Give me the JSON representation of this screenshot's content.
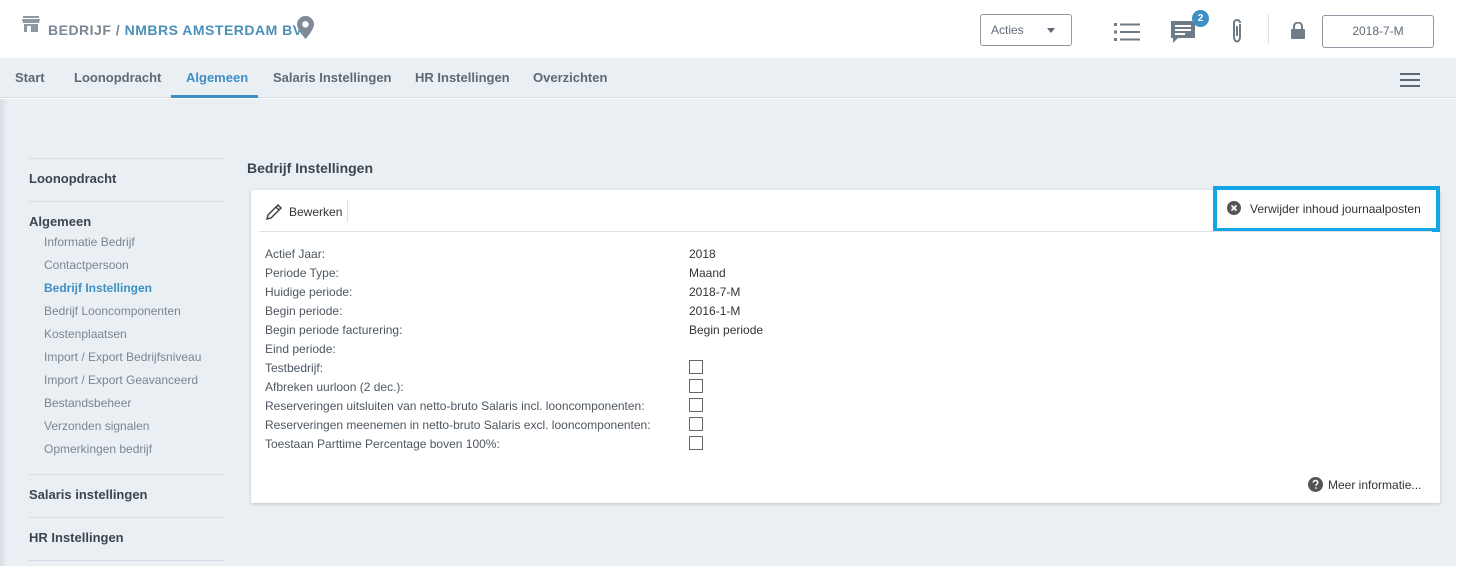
{
  "header": {
    "breadcrumb_prefix": "BEDRIJF /",
    "company": "NMBRS AMSTERDAM BV",
    "actions_label": "Acties",
    "chat_badge": "2",
    "period": "2018-7-M"
  },
  "nav": {
    "tabs": [
      {
        "label": "Start"
      },
      {
        "label": "Loonopdracht"
      },
      {
        "label": "Algemeen"
      },
      {
        "label": "Salaris Instellingen"
      },
      {
        "label": "HR Instellingen"
      },
      {
        "label": "Overzichten"
      }
    ],
    "active_tab": "Algemeen"
  },
  "sidebar": {
    "sections": [
      {
        "label": "Loonopdracht"
      },
      {
        "label": "Algemeen"
      },
      {
        "label": "Salaris instellingen"
      },
      {
        "label": "HR Instellingen"
      }
    ],
    "items": [
      {
        "label": "Informatie Bedrijf"
      },
      {
        "label": "Contactpersoon"
      },
      {
        "label": "Bedrijf Instellingen"
      },
      {
        "label": "Bedrijf Looncomponenten"
      },
      {
        "label": "Kostenplaatsen"
      },
      {
        "label": "Import / Export Bedrijfsniveau"
      },
      {
        "label": "Import / Export Geavanceerd"
      },
      {
        "label": "Bestandsbeheer"
      },
      {
        "label": "Verzonden signalen"
      },
      {
        "label": "Opmerkingen bedrijf"
      }
    ],
    "active_item": "Bedrijf Instellingen"
  },
  "main": {
    "title": "Bedrijf Instellingen",
    "edit_label": "Bewerken",
    "remove_label": "Verwijder inhoud journaalposten",
    "more_info": "Meer informatie...",
    "fields": [
      {
        "label": "Actief Jaar:",
        "value": "2018"
      },
      {
        "label": "Periode Type:",
        "value": "Maand"
      },
      {
        "label": "Huidige periode:",
        "value": "2018-7-M"
      },
      {
        "label": "Begin periode:",
        "value": "2016-1-M"
      },
      {
        "label": "Begin periode facturering:",
        "value": "Begin periode"
      },
      {
        "label": "Eind periode:",
        "value": ""
      }
    ],
    "checkboxes": [
      {
        "label": "Testbedrijf:",
        "checked": false
      },
      {
        "label": "Afbreken uurloon (2 dec.):",
        "checked": false
      },
      {
        "label": "Reserveringen uitsluiten van netto-bruto Salaris incl. looncomponenten:",
        "checked": false
      },
      {
        "label": "Reserveringen meenemen in netto-bruto Salaris excl. looncomponenten:",
        "checked": false
      },
      {
        "label": "Toestaan Parttime Percentage boven 100%:",
        "checked": false
      }
    ]
  },
  "colors": {
    "accent": "#3d8fc4",
    "highlight_border": "#14a6e4",
    "nav_bg": "#eaeff4"
  }
}
